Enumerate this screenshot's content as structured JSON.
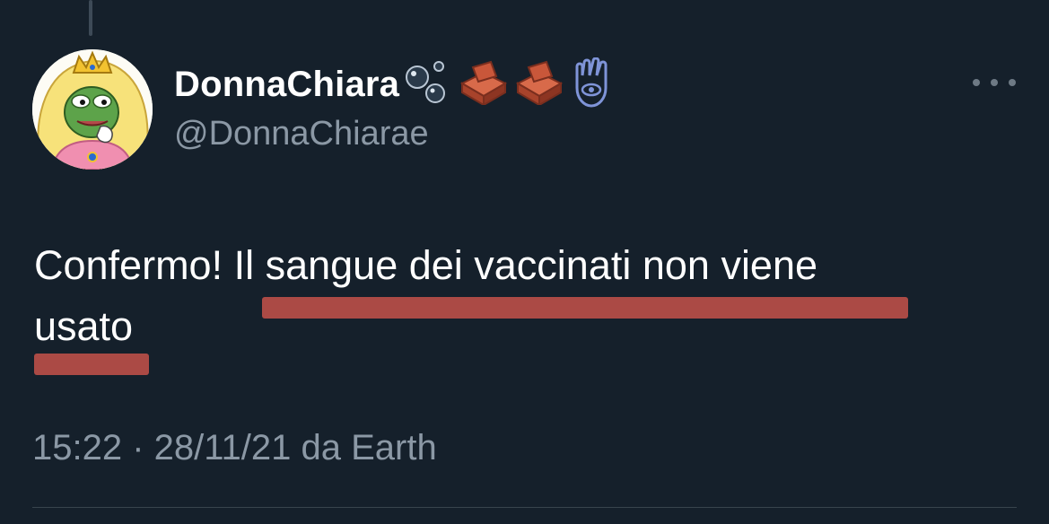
{
  "tweet": {
    "author": {
      "display_name": "DonnaChiara",
      "handle": "@DonnaChiarae",
      "name_badges": [
        "bubbles-icon",
        "brick-icon",
        "brick-icon",
        "hamsa-icon"
      ],
      "avatar_icon": "princess-frog-avatar"
    },
    "more_icon": "more-horizontal-icon",
    "text_lines": [
      "Confermo! Il sangue dei vaccinati non viene",
      "usato"
    ],
    "timestamp": "15:22 · 28/11/21 da Earth"
  },
  "colors": {
    "background": "#15202b",
    "text_primary": "#ffffff",
    "text_secondary": "#8b98a5",
    "highlight": "#c5524a"
  }
}
